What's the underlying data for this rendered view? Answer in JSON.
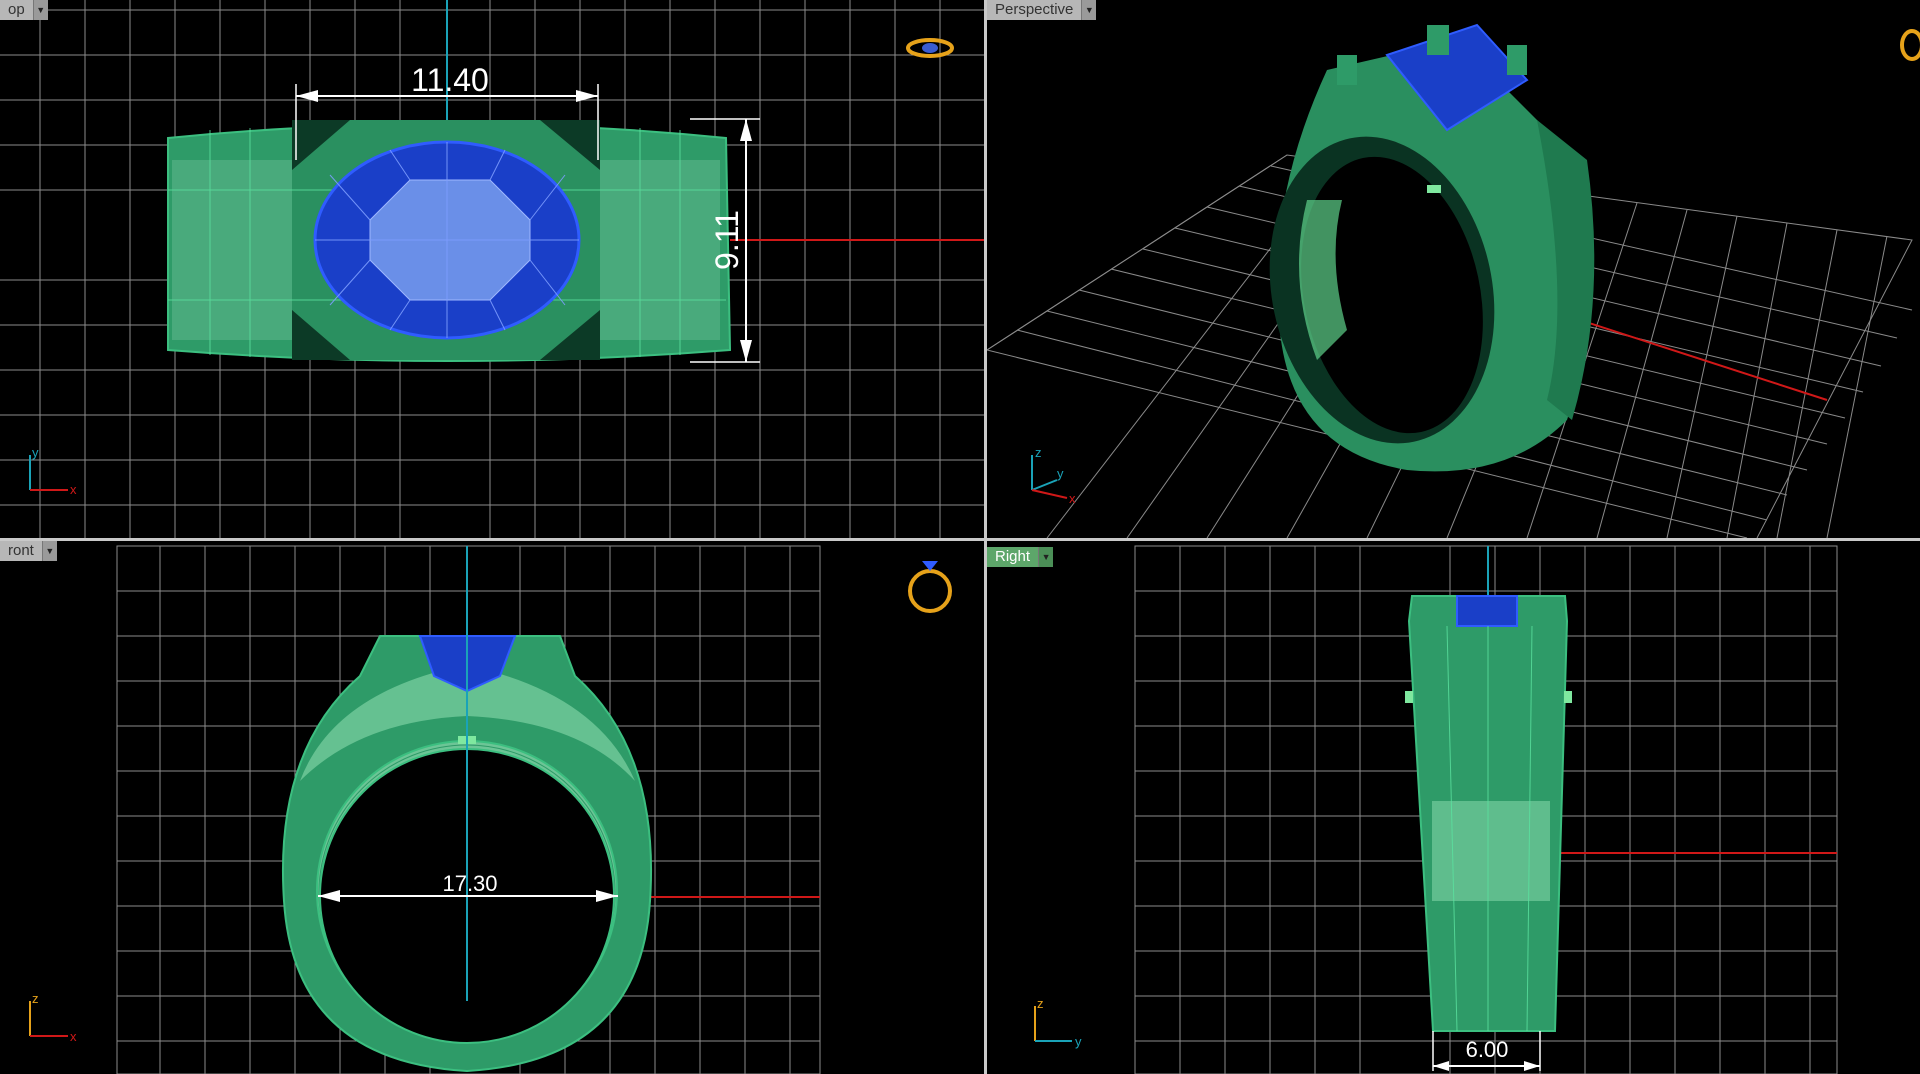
{
  "viewports": {
    "top": {
      "label": "op",
      "dim_width": "11.40",
      "dim_height": "9.11",
      "axis_a": "y",
      "axis_b": "x"
    },
    "perspective": {
      "label": "Perspective",
      "axis_z": "z",
      "axis_y": "y",
      "axis_x": "x"
    },
    "front": {
      "label": "ront",
      "dim_inner": "17.30",
      "axis_a": "z",
      "axis_b": "x"
    },
    "right": {
      "label": "Right",
      "dim_width": "6.00",
      "axis_a": "z",
      "axis_b": "y"
    }
  },
  "icons": {
    "top": "ring-render-icon",
    "front": "ring-outline-icon"
  },
  "colors": {
    "metal": "#2e9b68",
    "metal_light": "#6cc596",
    "gem": "#1a3fc8",
    "gem_light": "#5b86ff",
    "grid": "#9a9a9a",
    "axis_red": "#d01818",
    "axis_cyan": "#1aa3b8",
    "active_tab": "#5da66a",
    "icon_gold": "#e6a21a"
  }
}
